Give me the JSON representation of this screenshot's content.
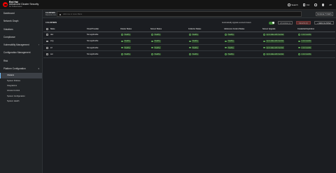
{
  "brand": {
    "line1": "Red Hat",
    "line2": "Advanced Cluster Security",
    "line3": "for Kubernetes",
    "accent": "#ee0000"
  },
  "topbar": {
    "search": "Search",
    "cli": "CLI",
    "help_icon": "help-icon",
    "theme_icon": "theme-icon",
    "user_initials": "AT"
  },
  "sidebar": {
    "items": [
      {
        "label": "Dashboard"
      },
      {
        "label": "Network Graph"
      },
      {
        "label": "Violations"
      },
      {
        "label": "Compliance"
      },
      {
        "label": "Vulnerability Management"
      },
      {
        "label": "Configuration Management"
      },
      {
        "label": "Risk"
      },
      {
        "label": "Platform Configuration"
      }
    ],
    "sub_items": [
      {
        "label": "Clusters"
      },
      {
        "label": "System Policies"
      },
      {
        "label": "Integrations"
      },
      {
        "label": "Access Control"
      },
      {
        "label": "System Configuration"
      },
      {
        "label": "System Health"
      }
    ]
  },
  "filter": {
    "scope_title": "CLUSTERS",
    "scope_sub": "Resource List",
    "search_placeholder": "Add one or more filters",
    "manage_label": "MANAGE TOKENS"
  },
  "toolbar": {
    "count_label": "4 CLUSTERS",
    "auto_upgrade_label": "Automatically upgrade secured clusters",
    "auto_upgrade_on": true,
    "upgrade_label": "UPGRADE (0)",
    "delete_label": "DELETE (0)",
    "new_label": "+ NEW CLUSTER"
  },
  "table": {
    "headers": [
      "Name",
      "Cloud Provider",
      "Cluster Status",
      "Sensor Status",
      "Collector Status",
      "Admission Control Status",
      "Sensor Upgrade",
      "Credential Expiration"
    ],
    "rows": [
      [
        "dev",
        "Not applicable",
        "Healthy",
        "Healthy",
        "Healthy",
        "Healthy",
        "Up to date with Central",
        "in 12 months"
      ],
      [
        "eng",
        "Not applicable",
        "Healthy",
        "Healthy",
        "Healthy",
        "Healthy",
        "Up to date with Central",
        "in 12 months"
      ],
      [
        "inf",
        "Not applicable",
        "Healthy",
        "Healthy",
        "Healthy",
        "Healthy",
        "Up to date with Central",
        "in 12 months"
      ],
      [
        "sat",
        "Not applicable",
        "Healthy",
        "Healthy",
        "Healthy",
        "Healthy",
        "Up to date with Central",
        "in 12 months"
      ]
    ]
  },
  "colors": {
    "healthy": "#5ba352",
    "healthy_bg": "#2d4a2a"
  }
}
